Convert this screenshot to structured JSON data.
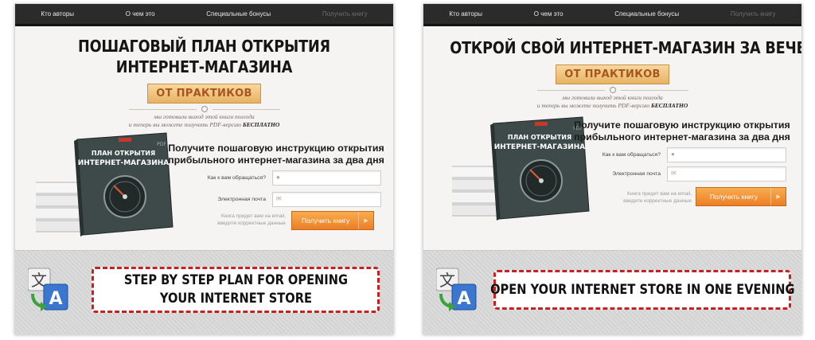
{
  "nav": {
    "items": [
      "Кто авторы",
      "О чем это",
      "Специальные бонусы",
      "Получить книгу"
    ]
  },
  "left": {
    "headline": [
      "ПОШАГОВЫЙ ПЛАН ОТКРЫТИЯ",
      "ИНТЕРНЕТ-МАГАЗИНА"
    ],
    "plate": "ОТ ПРАКТИКОВ",
    "note_line1": "мы готовили выход этой книги полгода",
    "note_line2_prefix": "и теперь вы можете получить PDF-версию ",
    "note_line2_bold": "БЕСПЛАТНО",
    "form_title": [
      "Получите пошаговую инструкцию открытия",
      "прибыльного интернет-магазина за два дня"
    ],
    "name_label": "Как к вам обращаться?",
    "email_label": "Электронная почта",
    "hint": [
      "Книга придет вам на email,",
      "введите корректные данные"
    ],
    "button": "Получить книгу",
    "caption": [
      "STEP BY STEP PLAN FOR OPENING",
      "YOUR INTERNET STORE"
    ]
  },
  "right": {
    "headline": [
      "ОТКРОЙ СВОЙ ИНТЕРНЕТ-МАГАЗИН ЗА ВЕЧЕР"
    ],
    "plate": "ОТ ПРАКТИКОВ",
    "note_line1": "мы готовили выход этой книги полгода",
    "note_line2_prefix": "и теперь вы можете получить PDF-версию ",
    "note_line2_bold": "БЕСПЛАТНО",
    "form_title": [
      "Получите пошаговую инструкцию открытия",
      "прибыльного интернет-магазина за два дня"
    ],
    "name_label": "Как к вам обращаться?",
    "email_label": "Электронная почта",
    "hint": [
      "Книга придет вам на email,",
      "введите корректные данные"
    ],
    "button": "Получить книгу",
    "caption": [
      "OPEN YOUR INTERNET STORE IN ONE EVENING"
    ]
  },
  "book": {
    "title_line1": "ПЛАН ОТКРЫТИЯ",
    "title_line2": "ИНТЕРНЕТ-МАГАЗИНА",
    "badge": "PDF"
  },
  "icons": {
    "translate": "translate-icon",
    "user": "user-icon",
    "mail": "mail-icon",
    "arrow": "arrow-right-icon"
  },
  "colors": {
    "nav_bg": "#2b2b2b",
    "plate_text": "#a9551e",
    "button": "#ec7e25",
    "caption_border": "#c82020"
  }
}
